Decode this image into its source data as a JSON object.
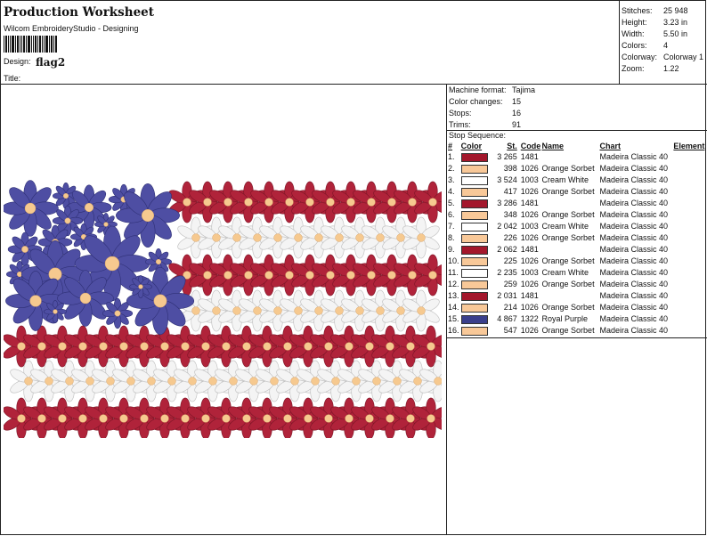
{
  "header": {
    "title": "Production Worksheet",
    "studio": "Wilcom EmbroideryStudio - Designing",
    "design_label": "Design:",
    "design_name": "flag2",
    "title_label": "Title:"
  },
  "stats": [
    {
      "label": "Stitches:",
      "value": "25 948"
    },
    {
      "label": "Height:",
      "value": "3.23 in"
    },
    {
      "label": "Width:",
      "value": "5.50 in"
    },
    {
      "label": "Colors:",
      "value": "4"
    },
    {
      "label": "Colorway:",
      "value": "Colorway 1"
    },
    {
      "label": "Zoom:",
      "value": "1.22"
    }
  ],
  "machine": [
    {
      "label": "Machine format:",
      "value": "Tajima"
    },
    {
      "label": "Color changes:",
      "value": "15"
    },
    {
      "label": "Stops:",
      "value": "16"
    },
    {
      "label": "Trims:",
      "value": "91"
    }
  ],
  "stop_sequence": {
    "label": "Stop Sequence:",
    "headers": {
      "num": "#",
      "color": "Color",
      "st": "St.",
      "code": "Code",
      "name": "Name",
      "chart": "Chart",
      "element": "Element"
    },
    "rows": [
      {
        "num": "1.",
        "color": "#a3172c",
        "st": "3 265",
        "code": "1481",
        "name": "",
        "chart": "Madeira Classic 40"
      },
      {
        "num": "2.",
        "color": "#f8c898",
        "st": "398",
        "code": "1026",
        "name": "Orange Sorbet",
        "chart": "Madeira Classic 40"
      },
      {
        "num": "3.",
        "color": "#ffffff",
        "st": "3 524",
        "code": "1003",
        "name": "Cream White",
        "chart": "Madeira Classic 40"
      },
      {
        "num": "4.",
        "color": "#f8c898",
        "st": "417",
        "code": "1026",
        "name": "Orange Sorbet",
        "chart": "Madeira Classic 40"
      },
      {
        "num": "5.",
        "color": "#a3172c",
        "st": "3 286",
        "code": "1481",
        "name": "",
        "chart": "Madeira Classic 40"
      },
      {
        "num": "6.",
        "color": "#f8c898",
        "st": "348",
        "code": "1026",
        "name": "Orange Sorbet",
        "chart": "Madeira Classic 40"
      },
      {
        "num": "7.",
        "color": "#ffffff",
        "st": "2 042",
        "code": "1003",
        "name": "Cream White",
        "chart": "Madeira Classic 40"
      },
      {
        "num": "8.",
        "color": "#f8c898",
        "st": "226",
        "code": "1026",
        "name": "Orange Sorbet",
        "chart": "Madeira Classic 40"
      },
      {
        "num": "9.",
        "color": "#a3172c",
        "st": "2 062",
        "code": "1481",
        "name": "",
        "chart": "Madeira Classic 40"
      },
      {
        "num": "10.",
        "color": "#f8c898",
        "st": "225",
        "code": "1026",
        "name": "Orange Sorbet",
        "chart": "Madeira Classic 40"
      },
      {
        "num": "11.",
        "color": "#ffffff",
        "st": "2 235",
        "code": "1003",
        "name": "Cream White",
        "chart": "Madeira Classic 40"
      },
      {
        "num": "12.",
        "color": "#f8c898",
        "st": "259",
        "code": "1026",
        "name": "Orange Sorbet",
        "chart": "Madeira Classic 40"
      },
      {
        "num": "13.",
        "color": "#a3172c",
        "st": "2 031",
        "code": "1481",
        "name": "",
        "chart": "Madeira Classic 40"
      },
      {
        "num": "14.",
        "color": "#f8c898",
        "st": "214",
        "code": "1026",
        "name": "Orange Sorbet",
        "chart": "Madeira Classic 40"
      },
      {
        "num": "15.",
        "color": "#3a3f8c",
        "st": "4 867",
        "code": "1322",
        "name": "Royal Purple",
        "chart": "Madeira Classic 40"
      },
      {
        "num": "16.",
        "color": "#f8c898",
        "st": "547",
        "code": "1026",
        "name": "Orange Sorbet",
        "chart": "Madeira Classic 40"
      }
    ]
  },
  "preview": {
    "colors": {
      "red": "#b0233a",
      "white": "#f4f4f4",
      "purple": "#4e4ea3",
      "center": "#f6c98f"
    }
  }
}
